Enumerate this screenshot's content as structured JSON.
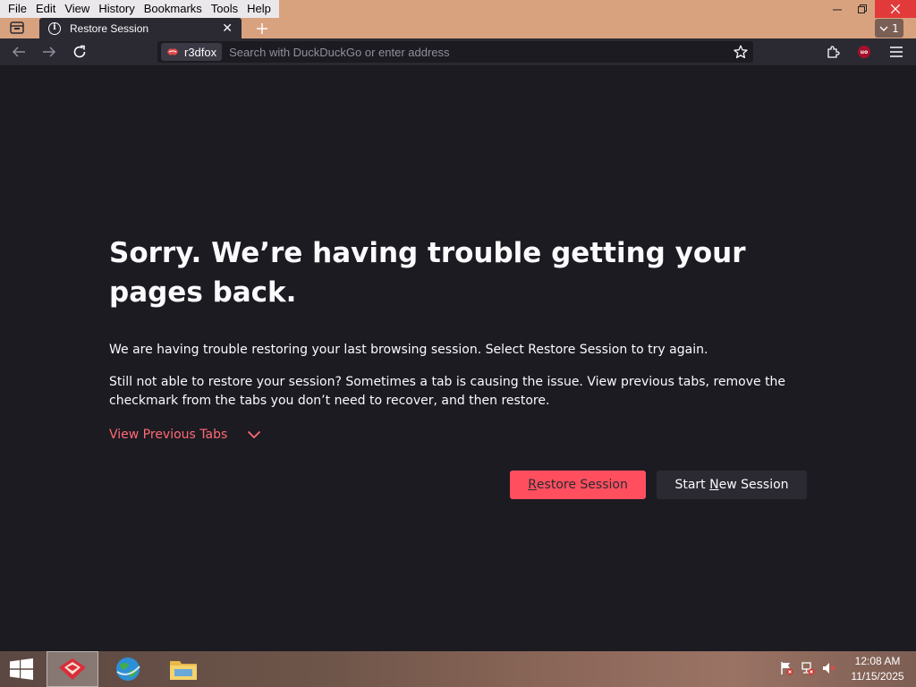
{
  "menubar": {
    "items": [
      "File",
      "Edit",
      "View",
      "History",
      "Bookmarks",
      "Tools",
      "Help"
    ]
  },
  "tabs": [
    {
      "title": "Restore Session",
      "close": "✕"
    }
  ],
  "tabcount": "1",
  "urlbar": {
    "identity_label": "r3dfox",
    "placeholder": "Search with DuckDuckGo or enter address"
  },
  "page": {
    "title": "Sorry. We’re having trouble getting your pages back.",
    "paragraph1": "We are having trouble restoring your last browsing session. Select Restore Session to try again.",
    "paragraph2": "Still not able to restore your session? Sometimes a tab is causing the issue. View previous tabs, remove the checkmark from the tabs you don’t need to recover, and then restore.",
    "view_previous_tabs": "View Previous Tabs",
    "restore_button": {
      "accesskey": "R",
      "rest": "estore Session"
    },
    "new_session_button": {
      "before": "Start ",
      "accesskey": "N",
      "after": "ew Session"
    }
  },
  "taskbar": {
    "time": "12:08 AM",
    "date": "11/15/2025"
  },
  "colors": {
    "accent": "#ff4f5e",
    "link": "#ff6a75",
    "background": "#1c1b22",
    "toolbar": "#2b2a33"
  }
}
